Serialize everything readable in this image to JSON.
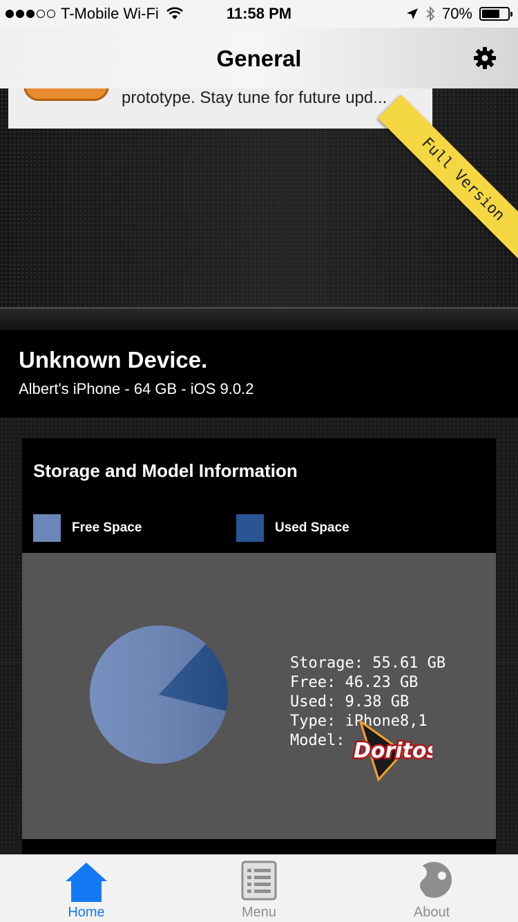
{
  "status_bar": {
    "carrier": "T-Mobile Wi-Fi",
    "time": "11:58 PM",
    "battery": "70%",
    "battery_level": 0.7,
    "signal_bars": 3
  },
  "nav": {
    "title": "General",
    "settings_icon": "gear-icon"
  },
  "notice": {
    "text": "prototype. Stay tune for future upd..."
  },
  "ribbon": {
    "text": "Full Version"
  },
  "device": {
    "name": "Unknown Device.",
    "subtitle": "Albert's iPhone - 64 GB - iOS 9.0.2"
  },
  "storage_card": {
    "title": "Storage and Model Information",
    "legend": [
      {
        "label": "Free Space",
        "color": "#6b86b9"
      },
      {
        "label": "Used Space",
        "color": "#2a5594"
      }
    ],
    "info": {
      "storage": "Storage: 55.61 GB",
      "free": "Free: 46.23 GB",
      "used": "Used: 9.38 GB",
      "type": "Type: iPhone8,1",
      "model": "Model: "
    },
    "overlay_logo": "Doritos"
  },
  "chart_data": {
    "type": "pie",
    "categories": [
      "Free Space",
      "Used Space"
    ],
    "values": [
      46.23,
      9.38
    ],
    "colors": [
      "#6b86b9",
      "#2a5594"
    ]
  },
  "tabs": [
    {
      "label": "Home",
      "icon": "home-icon",
      "active": true
    },
    {
      "label": "Menu",
      "icon": "menu-list-icon",
      "active": false
    },
    {
      "label": "About",
      "icon": "about-icon",
      "active": false
    }
  ],
  "colors": {
    "accent": "#1479f5",
    "ribbon": "#f5d742",
    "chart_bg": "#555555"
  }
}
